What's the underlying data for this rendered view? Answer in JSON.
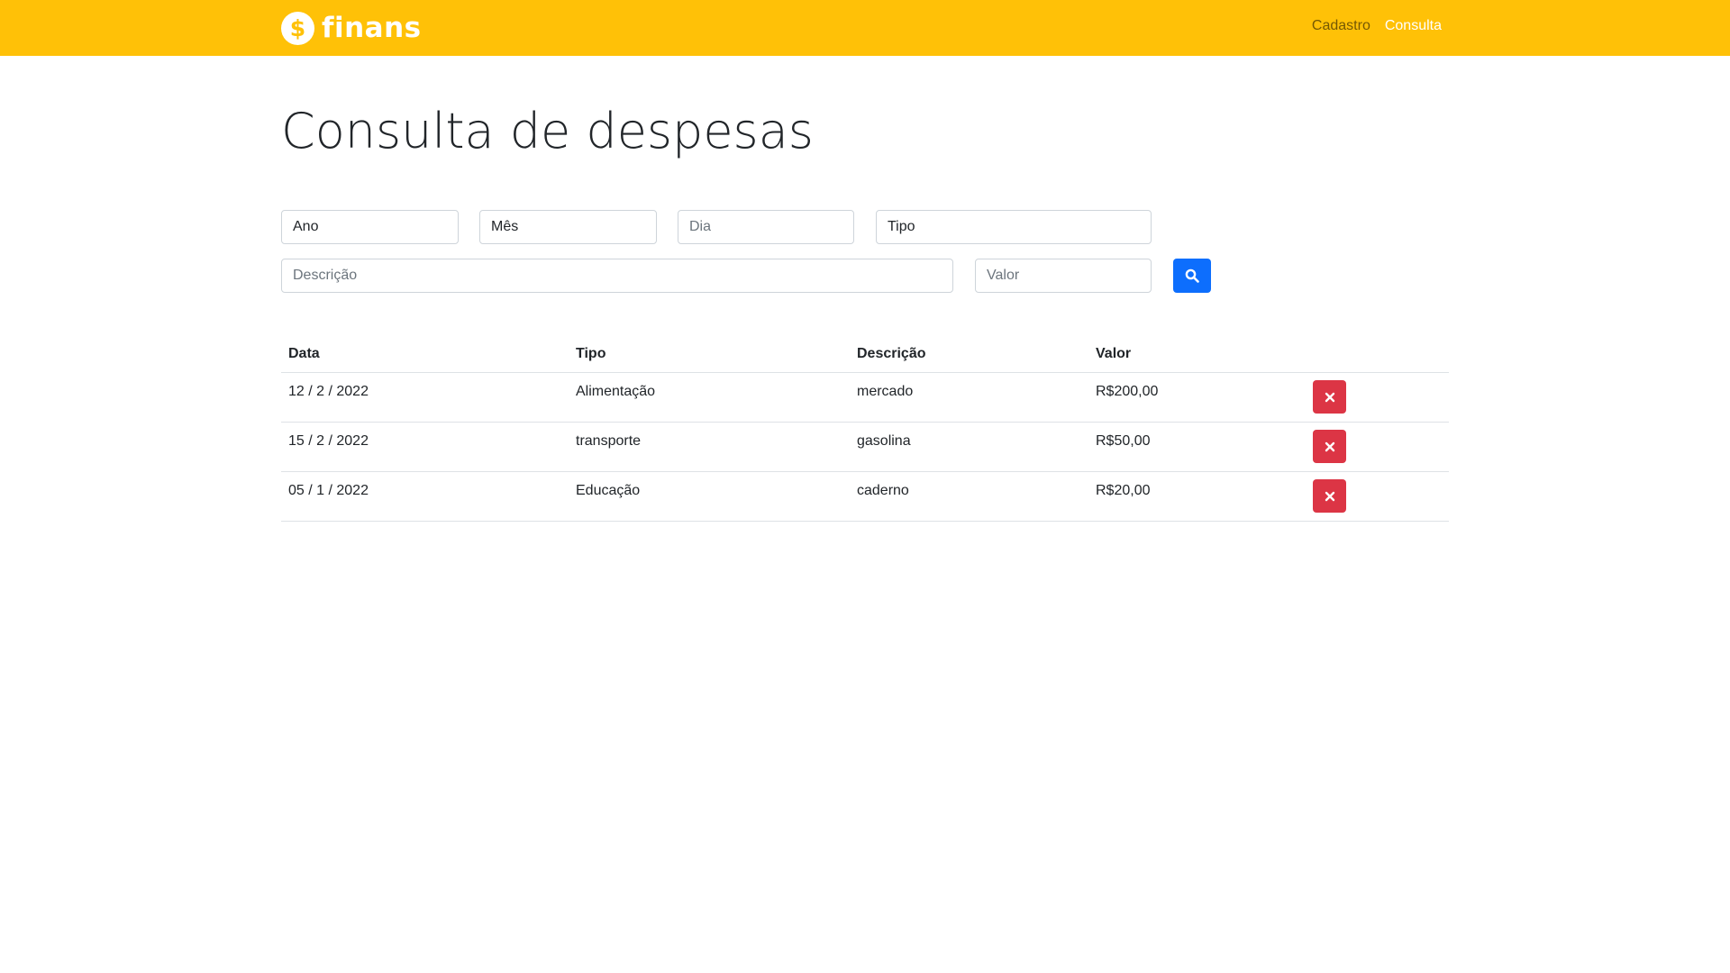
{
  "brand": {
    "icon": "dollar-icon",
    "icon_glyph": "$",
    "name": "finans",
    "color": "#ffc107"
  },
  "nav": {
    "links": [
      {
        "label": "Cadastro"
      },
      {
        "label": "Consulta"
      }
    ]
  },
  "page": {
    "title": "Consulta de despesas"
  },
  "filters": {
    "ano": {
      "placeholder": "Ano"
    },
    "mes": {
      "placeholder": "Mês"
    },
    "dia": {
      "placeholder": "Dia"
    },
    "tipo": {
      "placeholder": "Tipo"
    },
    "descricao": {
      "placeholder": "Descrição"
    },
    "valor": {
      "placeholder": "Valor"
    },
    "search_icon": "search-icon",
    "search_color": "#0d6efd"
  },
  "table": {
    "headers": [
      "Data",
      "Tipo",
      "Descrição",
      "Valor"
    ],
    "rows": [
      {
        "data": "12 / 2 / 2022",
        "tipo": "Alimentação",
        "descricao": "mercado",
        "valor": "R$200,00"
      },
      {
        "data": "15 / 2 / 2022",
        "tipo": "transporte",
        "descricao": "gasolina",
        "valor": "R$50,00"
      },
      {
        "data": "05 / 1 / 2022",
        "tipo": "Educação",
        "descricao": "caderno",
        "valor": "R$20,00"
      }
    ],
    "delete_icon": "close-icon",
    "delete_color": "#dc3545"
  }
}
